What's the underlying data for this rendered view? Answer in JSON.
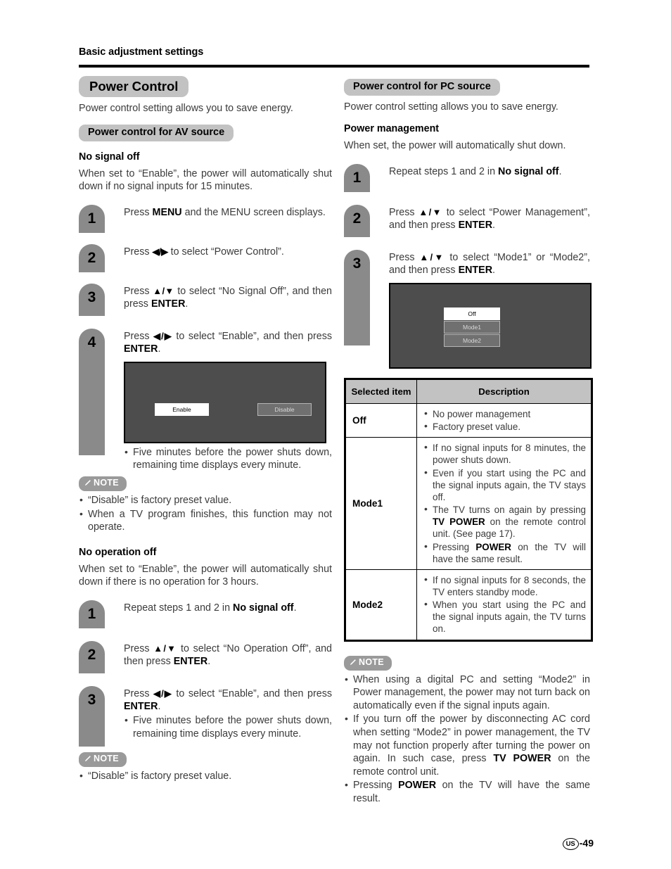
{
  "runhead": "Basic adjustment settings",
  "left": {
    "title_pill": "Power Control",
    "intro": "Power control setting allows you to save energy.",
    "av_pill": "Power control for AV source",
    "no_signal": {
      "heading": "No signal off",
      "desc": "When set to “Enable”, the power will automatically shut down if no signal inputs for 15 minutes.",
      "steps": [
        {
          "num": "1",
          "text_pre": "Press ",
          "bold1": "MENU",
          "text_mid": " and the MENU screen displays.",
          "bold2": "",
          "text_post": ""
        },
        {
          "num": "2",
          "text_pre": "Press ",
          "arrows": "◀/▶",
          "text_mid": " to select “Power Control”.",
          "bold2": "",
          "text_post": ""
        },
        {
          "num": "3",
          "text_pre": "Press ",
          "arrows": "▲/▼",
          "text_mid": " to select “No Signal Off”, and then press ",
          "bold2": "ENTER",
          "text_post": "."
        },
        {
          "num": "4",
          "text_pre": "Press ",
          "arrows": "◀/▶",
          "text_mid": " to select “Enable”, and then press ",
          "bold2": "ENTER",
          "text_post": "."
        }
      ],
      "screen": {
        "selected": "Enable",
        "unselected": "Disable"
      },
      "screen_note": "Five minutes before the power shuts down, remaining time displays every minute.",
      "note_label": "NOTE",
      "notes": [
        "“Disable” is factory preset value.",
        "When a TV program finishes, this function may not operate."
      ]
    },
    "no_operation": {
      "heading": "No operation off",
      "desc": "When set to “Enable”, the power will automatically shut down if there is no operation for 3 hours.",
      "steps": [
        {
          "num": "1",
          "text_pre": "Repeat steps 1 and 2 in ",
          "bold2": "No signal off",
          "text_post": "."
        },
        {
          "num": "2",
          "text_pre": "Press ",
          "arrows": "▲/▼",
          "text_mid": " to select “No Operation Off”, and then press ",
          "bold2": "ENTER",
          "text_post": "."
        },
        {
          "num": "3",
          "text_pre": "Press ",
          "arrows": "◀/▶",
          "text_mid": " to select “Enable”, and then press ",
          "bold2": "ENTER",
          "text_post": "."
        }
      ],
      "step3_bullet": "Five minutes before the power shuts down, remaining time displays every minute.",
      "note_label": "NOTE",
      "notes": [
        "“Disable” is factory preset value."
      ]
    }
  },
  "right": {
    "pc_pill": "Power control for PC source",
    "intro": "Power control setting allows you to save energy.",
    "pm_heading": "Power management",
    "pm_desc": "When set, the power will automatically shut down.",
    "steps": [
      {
        "num": "1",
        "text_pre": "Repeat steps 1 and 2 in ",
        "bold2": "No signal off",
        "text_post": "."
      },
      {
        "num": "2",
        "text_pre": "Press ",
        "arrows": "▲/▼",
        "text_mid": " to select “Power Management”, and then press ",
        "bold2": "ENTER",
        "text_post": "."
      },
      {
        "num": "3",
        "text_pre": "Press ",
        "arrows": "▲/▼",
        "text_mid": " to select “Mode1” or “Mode2”, and then press ",
        "bold2": "ENTER",
        "text_post": "."
      }
    ],
    "screen": {
      "selected": "Off",
      "option1": "Mode1",
      "option2": "Mode2"
    },
    "table": {
      "headers": [
        "Selected item",
        "Description"
      ],
      "rows": [
        {
          "item": "Off",
          "lines": [
            [
              {
                "t": "No power management"
              }
            ],
            [
              {
                "t": "Factory preset value."
              }
            ]
          ]
        },
        {
          "item": "Mode1",
          "lines": [
            [
              {
                "t": "If no signal inputs for 8 minutes, the power shuts down."
              }
            ],
            [
              {
                "t": "Even if you start using the PC and the signal inputs again, the TV stays off."
              }
            ],
            [
              {
                "t": "The TV turns on again by pressing "
              },
              {
                "t": "TV POWER",
                "b": true
              },
              {
                "t": " on the remote control unit. (See page 17)."
              }
            ],
            [
              {
                "t": "Pressing "
              },
              {
                "t": "POWER",
                "b": true
              },
              {
                "t": " on the TV will have the same result."
              }
            ]
          ]
        },
        {
          "item": "Mode2",
          "lines": [
            [
              {
                "t": "If no signal inputs for 8 seconds, the TV enters standby mode."
              }
            ],
            [
              {
                "t": "When you start using the PC and the signal inputs again, the TV turns on."
              }
            ]
          ]
        }
      ]
    },
    "note_label": "NOTE",
    "notes": [
      [
        {
          "t": "When using a digital PC and setting “Mode2” in Power management, the power may not turn back on automatically even if the signal inputs again."
        }
      ],
      [
        {
          "t": "If you turn off the power by disconnecting AC cord when setting “Mode2” in power management, the TV may not function properly after turning the power on again. In such case, press "
        },
        {
          "t": "TV POWER",
          "b": true
        },
        {
          "t": " on the remote control unit."
        }
      ],
      [
        {
          "t": "Pressing "
        },
        {
          "t": "POWER",
          "b": true
        },
        {
          "t": " on the TV will have the same result."
        }
      ]
    ]
  },
  "footer": {
    "region": "US",
    "page": "-49"
  }
}
